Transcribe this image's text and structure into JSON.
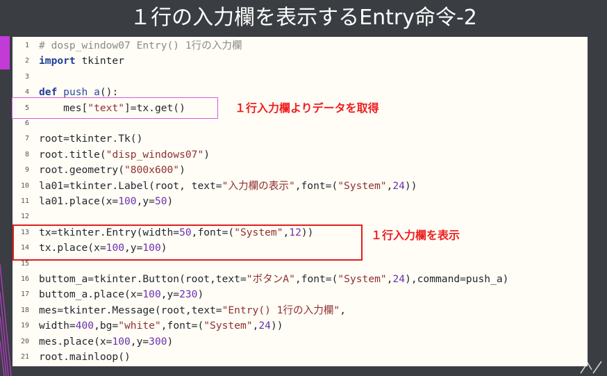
{
  "slide": {
    "title": "１行の入力欄を表示するEntry命令-2"
  },
  "code": {
    "lines": [
      {
        "n": "1",
        "parts": [
          {
            "t": "# dosp_window07 Entry() 1行の入力欄",
            "c": "cm"
          }
        ]
      },
      {
        "n": "2",
        "parts": [
          {
            "t": "import",
            "c": "kw"
          },
          {
            "t": " tkinter",
            "c": ""
          }
        ]
      },
      {
        "n": "3",
        "parts": []
      },
      {
        "n": "4",
        "parts": [
          {
            "t": "def",
            "c": "kw"
          },
          {
            "t": " ",
            "c": ""
          },
          {
            "t": "push_a",
            "c": "fn"
          },
          {
            "t": "():",
            "c": ""
          }
        ]
      },
      {
        "n": "5",
        "parts": [
          {
            "t": "    mes[",
            "c": ""
          },
          {
            "t": "\"text\"",
            "c": "st"
          },
          {
            "t": "]=tx.get()",
            "c": ""
          }
        ]
      },
      {
        "n": "6",
        "parts": []
      },
      {
        "n": "7",
        "parts": [
          {
            "t": "root=tkinter.Tk()",
            "c": ""
          }
        ]
      },
      {
        "n": "8",
        "parts": [
          {
            "t": "root.title(",
            "c": ""
          },
          {
            "t": "\"disp_windows07\"",
            "c": "st"
          },
          {
            "t": ")",
            "c": ""
          }
        ]
      },
      {
        "n": "9",
        "parts": [
          {
            "t": "root.geometry(",
            "c": ""
          },
          {
            "t": "\"800x600\"",
            "c": "st"
          },
          {
            "t": ")",
            "c": ""
          }
        ]
      },
      {
        "n": "10",
        "parts": [
          {
            "t": "la01=tkinter.Label(root, text=",
            "c": ""
          },
          {
            "t": "\"入力欄の表示\"",
            "c": "st"
          },
          {
            "t": ",font=(",
            "c": ""
          },
          {
            "t": "\"System\"",
            "c": "st"
          },
          {
            "t": ",",
            "c": ""
          },
          {
            "t": "24",
            "c": "nm"
          },
          {
            "t": "))",
            "c": ""
          }
        ]
      },
      {
        "n": "11",
        "parts": [
          {
            "t": "la01.place(x=",
            "c": ""
          },
          {
            "t": "100",
            "c": "nm"
          },
          {
            "t": ",y=",
            "c": ""
          },
          {
            "t": "50",
            "c": "nm"
          },
          {
            "t": ")",
            "c": ""
          }
        ]
      },
      {
        "n": "12",
        "parts": []
      },
      {
        "n": "13",
        "parts": [
          {
            "t": "tx=tkinter.Entry(width=",
            "c": ""
          },
          {
            "t": "50",
            "c": "nm"
          },
          {
            "t": ",font=(",
            "c": ""
          },
          {
            "t": "\"System\"",
            "c": "st"
          },
          {
            "t": ",",
            "c": ""
          },
          {
            "t": "12",
            "c": "nm"
          },
          {
            "t": "))",
            "c": ""
          }
        ]
      },
      {
        "n": "14",
        "parts": [
          {
            "t": "tx.place(x=",
            "c": ""
          },
          {
            "t": "100",
            "c": "nm"
          },
          {
            "t": ",y=",
            "c": ""
          },
          {
            "t": "100",
            "c": "nm"
          },
          {
            "t": ")",
            "c": ""
          }
        ]
      },
      {
        "n": "15",
        "parts": []
      },
      {
        "n": "16",
        "parts": [
          {
            "t": "buttom_a=tkinter.Button(root,text=",
            "c": ""
          },
          {
            "t": "\"ボタンA\"",
            "c": "st"
          },
          {
            "t": ",font=(",
            "c": ""
          },
          {
            "t": "\"System\"",
            "c": "st"
          },
          {
            "t": ",",
            "c": ""
          },
          {
            "t": "24",
            "c": "nm"
          },
          {
            "t": "),command=push_a)",
            "c": ""
          }
        ]
      },
      {
        "n": "17",
        "parts": [
          {
            "t": "buttom_a.place(x=",
            "c": ""
          },
          {
            "t": "100",
            "c": "nm"
          },
          {
            "t": ",y=",
            "c": ""
          },
          {
            "t": "230",
            "c": "nm"
          },
          {
            "t": ")",
            "c": ""
          }
        ]
      },
      {
        "n": "18",
        "parts": [
          {
            "t": "mes=tkinter.Message(root,text=",
            "c": ""
          },
          {
            "t": "\"Entry() 1行の入力欄\"",
            "c": "st"
          },
          {
            "t": ",",
            "c": ""
          }
        ]
      },
      {
        "n": "19",
        "parts": [
          {
            "t": "width=",
            "c": ""
          },
          {
            "t": "400",
            "c": "nm"
          },
          {
            "t": ",bg=",
            "c": ""
          },
          {
            "t": "\"white\"",
            "c": "st"
          },
          {
            "t": ",font=(",
            "c": ""
          },
          {
            "t": "\"System\"",
            "c": "st"
          },
          {
            "t": ",",
            "c": ""
          },
          {
            "t": "24",
            "c": "nm"
          },
          {
            "t": "))",
            "c": ""
          }
        ]
      },
      {
        "n": "20",
        "parts": [
          {
            "t": "mes.place(x=",
            "c": ""
          },
          {
            "t": "100",
            "c": "nm"
          },
          {
            "t": ",y=",
            "c": ""
          },
          {
            "t": "300",
            "c": "nm"
          },
          {
            "t": ")",
            "c": ""
          }
        ]
      },
      {
        "n": "21",
        "parts": [
          {
            "t": "root.mainloop()",
            "c": ""
          }
        ]
      }
    ]
  },
  "annotations": {
    "note_get": "１行入力欄よりデータを取得",
    "note_entry": "１行入力欄を表示"
  },
  "colors": {
    "background": "#3a3d42",
    "accent": "#c23bd6",
    "highlight_red": "#e01e1e",
    "highlight_magenta": "#d85ad8"
  }
}
